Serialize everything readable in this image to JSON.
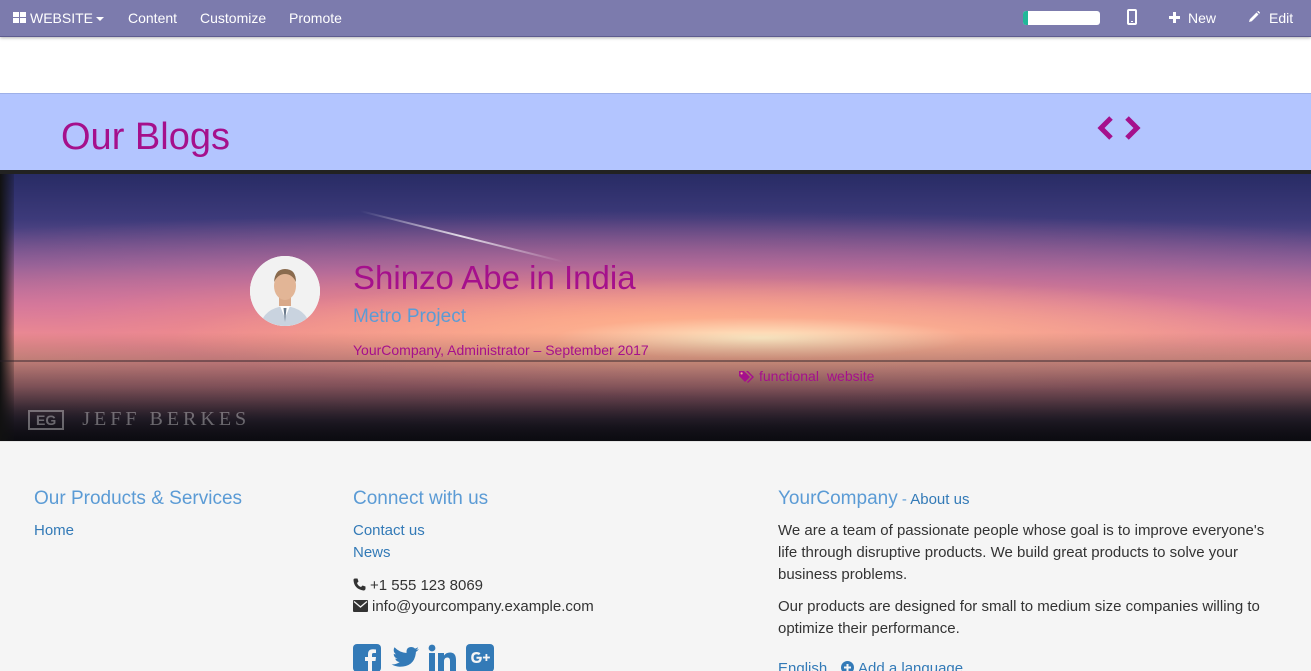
{
  "topbar": {
    "website_label": "WEBSITE",
    "menu": [
      "Content",
      "Customize",
      "Promote"
    ],
    "progress_percent": 6,
    "new_label": "New",
    "edit_label": "Edit",
    "bar_color": "#7c7bad"
  },
  "blog": {
    "title": "Our Blogs",
    "accent_color": "#a5108c",
    "band_color": "#b3c5ff"
  },
  "post": {
    "title": "Shinzo Abe in India",
    "subtitle": "Metro Project",
    "meta": "YourCompany, Administrator – September 2017",
    "tags": [
      "functional",
      "website"
    ],
    "watermark_box": "EG",
    "watermark_text": "JEFF BERKES"
  },
  "footer": {
    "products_heading": "Our Products & Services",
    "products_links": [
      "Home"
    ],
    "connect_heading": "Connect with us",
    "connect_links": [
      "Contact us",
      "News"
    ],
    "phone": "+1 555 123 8069",
    "email": "info@yourcompany.example.com",
    "social": [
      "facebook-icon",
      "twitter-icon",
      "linkedin-icon",
      "google-plus-icon"
    ],
    "company_name": "YourCompany",
    "about_link": "About us",
    "about_para1": "We are a team of passionate people whose goal is to improve everyone's life through disruptive products. We build great products to solve your business problems.",
    "about_para2": "Our products are designed for small to medium size companies willing to optimize their performance.",
    "language": "English",
    "add_language": "Add a language"
  }
}
